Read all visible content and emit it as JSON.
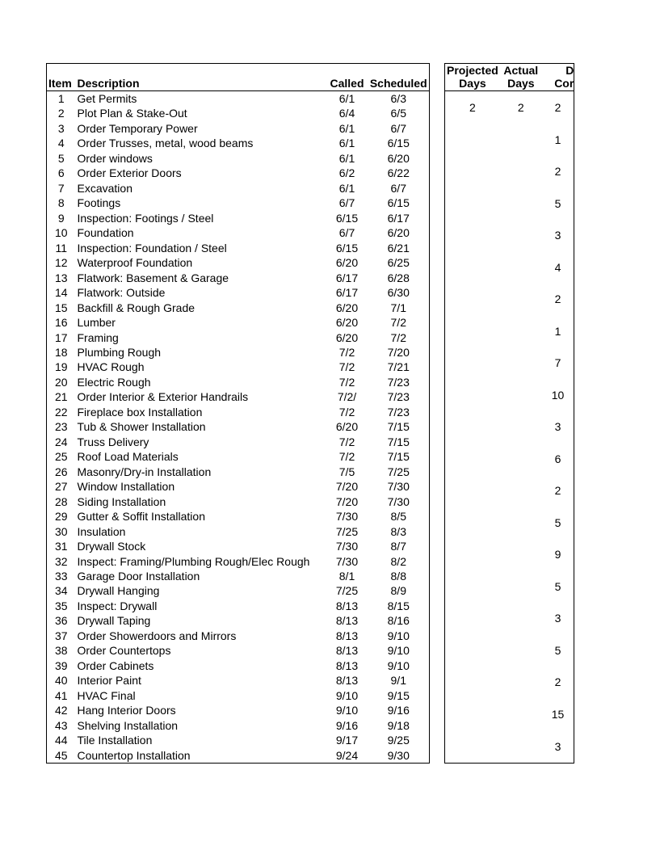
{
  "left": {
    "headers": {
      "item": "Item",
      "description": "Description",
      "called": "Called",
      "scheduled": "Scheduled"
    },
    "rows": [
      {
        "n": "1",
        "d": "Get Permits",
        "c": "6/1",
        "s": "6/3"
      },
      {
        "n": "2",
        "d": "Plot Plan & Stake-Out",
        "c": "6/4",
        "s": "6/5"
      },
      {
        "n": "3",
        "d": "Order Temporary Power",
        "c": "6/1",
        "s": "6/7"
      },
      {
        "n": "4",
        "d": "Order Trusses, metal, wood beams",
        "c": "6/1",
        "s": "6/15"
      },
      {
        "n": "5",
        "d": "Order windows",
        "c": "6/1",
        "s": "6/20"
      },
      {
        "n": "6",
        "d": "Order Exterior Doors",
        "c": "6/2",
        "s": "6/22"
      },
      {
        "n": "7",
        "d": "Excavation",
        "c": "6/1",
        "s": "6/7"
      },
      {
        "n": "8",
        "d": "Footings",
        "c": "6/7",
        "s": "6/15"
      },
      {
        "n": "9",
        "d": "Inspection: Footings / Steel",
        "c": "6/15",
        "s": "6/17"
      },
      {
        "n": "10",
        "d": "Foundation",
        "c": "6/7",
        "s": "6/20"
      },
      {
        "n": "11",
        "d": "Inspection: Foundation / Steel",
        "c": "6/15",
        "s": "6/21"
      },
      {
        "n": "12",
        "d": "Waterproof Foundation",
        "c": "6/20",
        "s": "6/25"
      },
      {
        "n": "13",
        "d": "Flatwork: Basement & Garage",
        "c": "6/17",
        "s": "6/28"
      },
      {
        "n": "14",
        "d": "Flatwork: Outside",
        "c": "6/17",
        "s": "6/30"
      },
      {
        "n": "15",
        "d": "Backfill & Rough Grade",
        "c": "6/20",
        "s": "7/1"
      },
      {
        "n": "16",
        "d": "Lumber",
        "c": "6/20",
        "s": "7/2"
      },
      {
        "n": "17",
        "d": "Framing",
        "c": "6/20",
        "s": "7/2"
      },
      {
        "n": "18",
        "d": "Plumbing Rough",
        "c": "7/2",
        "s": "7/20"
      },
      {
        "n": "19",
        "d": "HVAC Rough",
        "c": "7/2",
        "s": "7/21"
      },
      {
        "n": "20",
        "d": "Electric Rough",
        "c": "7/2",
        "s": "7/23"
      },
      {
        "n": "21",
        "d": "Order Interior & Exterior Handrails",
        "c": "7/2/",
        "s": "7/23"
      },
      {
        "n": "22",
        "d": "Fireplace box Installation",
        "c": "7/2",
        "s": "7/23"
      },
      {
        "n": "23",
        "d": "Tub & Shower Installation",
        "c": "6/20",
        "s": "7/15"
      },
      {
        "n": "24",
        "d": "Truss Delivery",
        "c": "7/2",
        "s": "7/15"
      },
      {
        "n": "25",
        "d": "Roof Load Materials",
        "c": "7/2",
        "s": "7/15"
      },
      {
        "n": "26",
        "d": "Masonry/Dry-in Installation",
        "c": "7/5",
        "s": "7/25"
      },
      {
        "n": "27",
        "d": "Window Installation",
        "c": "7/20",
        "s": "7/30"
      },
      {
        "n": "28",
        "d": "Siding Installation",
        "c": "7/20",
        "s": "7/30"
      },
      {
        "n": "29",
        "d": "Gutter & Soffit Installation",
        "c": "7/30",
        "s": "8/5"
      },
      {
        "n": "30",
        "d": "Insulation",
        "c": "7/25",
        "s": "8/3"
      },
      {
        "n": "31",
        "d": "Drywall Stock",
        "c": "7/30",
        "s": "8/7"
      },
      {
        "n": "32",
        "d": "Inspect: Framing/Plumbing Rough/Elec Rough",
        "c": "7/30",
        "s": "8/2"
      },
      {
        "n": "33",
        "d": "Garage Door Installation",
        "c": "8/1",
        "s": "8/8"
      },
      {
        "n": "34",
        "d": "Drywall Hanging",
        "c": "7/25",
        "s": "8/9"
      },
      {
        "n": "35",
        "d": "Inspect: Drywall",
        "c": "8/13",
        "s": "8/15"
      },
      {
        "n": "36",
        "d": "Drywall Taping",
        "c": "8/13",
        "s": "8/16"
      },
      {
        "n": "37",
        "d": "Order Showerdoors and Mirrors",
        "c": "8/13",
        "s": "9/10"
      },
      {
        "n": "38",
        "d": "Order Countertops",
        "c": "8/13",
        "s": "9/10"
      },
      {
        "n": "39",
        "d": "Order Cabinets",
        "c": "8/13",
        "s": "9/10"
      },
      {
        "n": "40",
        "d": "Interior Paint",
        "c": "8/13",
        "s": "9/1"
      },
      {
        "n": "41",
        "d": "HVAC Final",
        "c": "9/10",
        "s": "9/15"
      },
      {
        "n": "42",
        "d": "Hang Interior Doors",
        "c": "9/10",
        "s": "9/16"
      },
      {
        "n": "43",
        "d": "Shelving Installation",
        "c": "9/16",
        "s": "9/18"
      },
      {
        "n": "44",
        "d": "Tile Installation",
        "c": "9/17",
        "s": "9/25"
      },
      {
        "n": "45",
        "d": "Countertop Installation",
        "c": "9/24",
        "s": "9/30"
      }
    ]
  },
  "right": {
    "headers": {
      "projected_l1": "Projected",
      "projected_l2": "Days",
      "actual_l1": "Actual",
      "actual_l2": "Days",
      "col3_l1": "D",
      "col3_l2": "Cor"
    },
    "rows": [
      {
        "p": "",
        "a": "",
        "x": ""
      },
      {
        "p": "",
        "a": "",
        "x": ""
      },
      {
        "p": "2",
        "a": "2",
        "x": "2"
      },
      {
        "p": "",
        "a": "",
        "x": ""
      },
      {
        "p": "",
        "a": "",
        "x": "1"
      },
      {
        "p": "",
        "a": "",
        "x": ""
      },
      {
        "p": "",
        "a": "",
        "x": "2"
      },
      {
        "p": "",
        "a": "",
        "x": ""
      },
      {
        "p": "",
        "a": "",
        "x": "5"
      },
      {
        "p": "",
        "a": "",
        "x": ""
      },
      {
        "p": "",
        "a": "",
        "x": "3"
      },
      {
        "p": "",
        "a": "",
        "x": ""
      },
      {
        "p": "",
        "a": "",
        "x": "4"
      },
      {
        "p": "",
        "a": "",
        "x": ""
      },
      {
        "p": "",
        "a": "",
        "x": "2"
      },
      {
        "p": "",
        "a": "",
        "x": ""
      },
      {
        "p": "",
        "a": "",
        "x": "1"
      },
      {
        "p": "",
        "a": "",
        "x": ""
      },
      {
        "p": "",
        "a": "",
        "x": ""
      },
      {
        "p": "",
        "a": "",
        "x": ""
      },
      {
        "p": "",
        "a": "",
        "x": "7"
      },
      {
        "p": "",
        "a": "",
        "x": ""
      },
      {
        "p": "",
        "a": "",
        "x": "10"
      },
      {
        "p": "",
        "a": "",
        "x": ""
      },
      {
        "p": "",
        "a": "",
        "x": "3"
      },
      {
        "p": "",
        "a": "",
        "x": ""
      },
      {
        "p": "",
        "a": "",
        "x": "6"
      },
      {
        "p": "",
        "a": "",
        "x": ""
      },
      {
        "p": "",
        "a": "",
        "x": "2"
      },
      {
        "p": "",
        "a": "",
        "x": ""
      },
      {
        "p": "",
        "a": "",
        "x": "5"
      },
      {
        "p": "",
        "a": "",
        "x": ""
      },
      {
        "p": "",
        "a": "",
        "x": "9"
      },
      {
        "p": "",
        "a": "",
        "x": ""
      },
      {
        "p": "",
        "a": "",
        "x": "5"
      },
      {
        "p": "",
        "a": "",
        "x": ""
      },
      {
        "p": "",
        "a": "",
        "x": "3"
      },
      {
        "p": "",
        "a": "",
        "x": ""
      },
      {
        "p": "",
        "a": "",
        "x": "5"
      },
      {
        "p": "",
        "a": "",
        "x": ""
      },
      {
        "p": "",
        "a": "",
        "x": "2"
      },
      {
        "p": "",
        "a": "",
        "x": ""
      },
      {
        "p": "",
        "a": "",
        "x": "15"
      },
      {
        "p": "",
        "a": "",
        "x": ""
      },
      {
        "p": "",
        "a": "",
        "x": "3"
      }
    ]
  }
}
